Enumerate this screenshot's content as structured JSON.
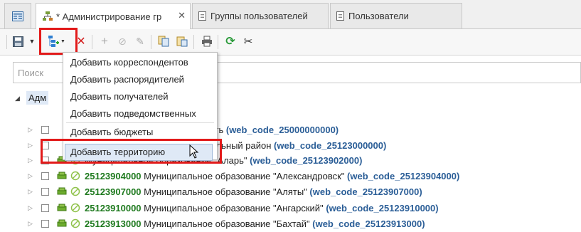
{
  "tabs": [
    {
      "label": "* Администрирование гр",
      "active": true
    },
    {
      "label": "Группы пользователей",
      "active": false
    },
    {
      "label": "Пользователи",
      "active": false
    }
  ],
  "search": {
    "placeholder": "Поиск"
  },
  "tree": {
    "root_label": "Адм"
  },
  "menu": {
    "items": [
      "Добавить корреспондентов",
      "Добавить распорядителей",
      "Добавить получателей",
      "Добавить подведомственных",
      "Добавить бюджеты",
      "Добавить территорию"
    ],
    "highlighted_index": 5
  },
  "rows": [
    {
      "code": "",
      "name": "сть",
      "web": "(web_code_25000000000)"
    },
    {
      "code": "",
      "name": "ипальный район",
      "web": "(web_code_25123000000)"
    },
    {
      "code": "",
      "name": "Муниципальное образование \"Аларь\"",
      "web": "(web_code_25123902000)"
    },
    {
      "code": "25123904000",
      "name": "Муниципальное образование \"Александровск\"",
      "web": "(web_code_25123904000)"
    },
    {
      "code": "25123907000",
      "name": "Муниципальное образование \"Аляты\"",
      "web": "(web_code_25123907000)"
    },
    {
      "code": "25123910000",
      "name": "Муниципальное образование \"Ангарский\"",
      "web": "(web_code_25123910000)"
    },
    {
      "code": "25123913000",
      "name": "Муниципальное образование \"Бахтай\"",
      "web": "(web_code_25123913000)"
    }
  ],
  "colors": {
    "accent_red": "#e21a1a",
    "code_green": "#1f7a1f",
    "web_blue": "#2b5e97"
  }
}
